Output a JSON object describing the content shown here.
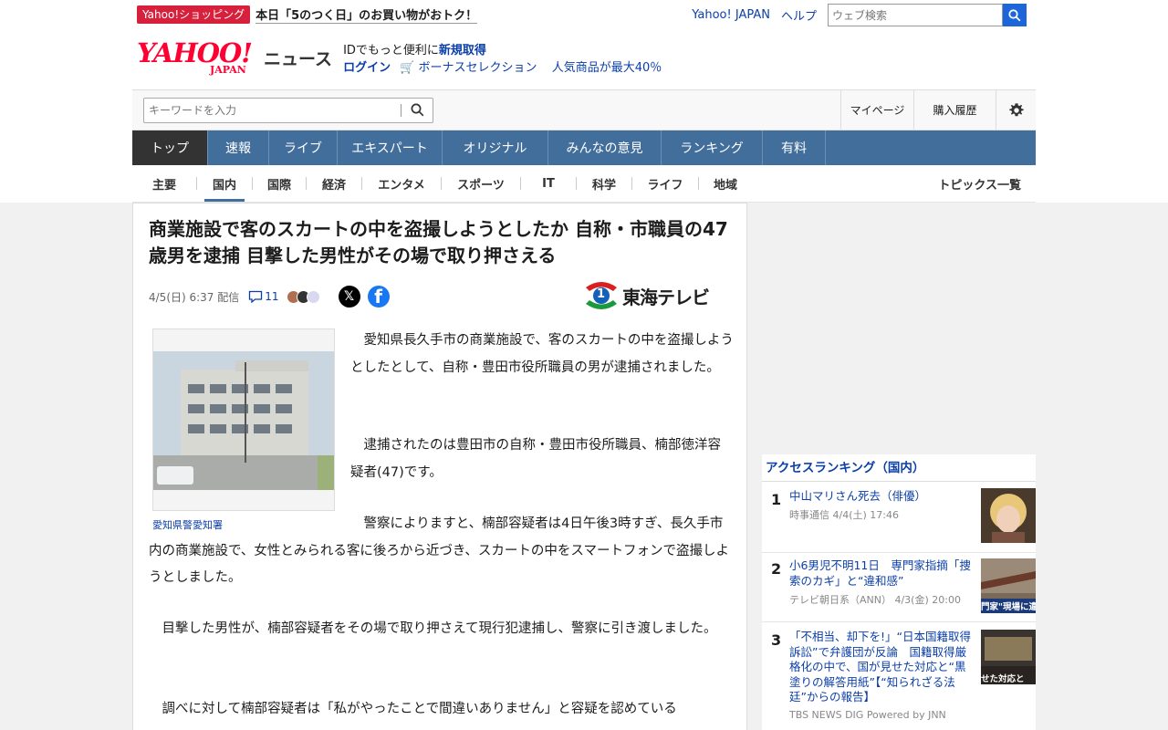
{
  "promo": {
    "badge": "Yahoo!ショッピング",
    "text": "本日「5のつく日」のお買い物がおトク！"
  },
  "header_links": {
    "yahoo_japan": "Yahoo! JAPAN",
    "help": "ヘルプ"
  },
  "web_search": {
    "placeholder": "ウェブ検索"
  },
  "logo": {
    "main": "YAHOO!",
    "sub": "JAPAN",
    "service": "ニュース"
  },
  "id_promo": {
    "line1_prefix": "IDでもっと便利に",
    "line1_link": "新規取得",
    "login": "ログイン",
    "bonus": "ボーナスセレクション",
    "popular": "人気商品が最大40％"
  },
  "keyword_search": {
    "placeholder": "キーワードを入力"
  },
  "util": {
    "mypage": "マイページ",
    "history": "購入履歴"
  },
  "main_nav": [
    "トップ",
    "速報",
    "ライブ",
    "エキスパート",
    "オリジナル",
    "みんなの意見",
    "ランキング",
    "有料"
  ],
  "sub_nav": [
    "主要",
    "国内",
    "国際",
    "経済",
    "エンタメ",
    "スポーツ",
    "IT",
    "科学",
    "ライフ",
    "地域"
  ],
  "topics_link": "トピックス一覧",
  "article": {
    "title": "商業施設で客のスカートの中を盗撮しようとしたか 自称・市職員の47歳男を逮捕 目撃した男性がその場で取り押さえる",
    "date": "4/5(日) 6:37 配信",
    "comment_count": "11",
    "source": "東海テレビ",
    "source_mark": "1",
    "photo_caption": "愛知県警愛知署",
    "paragraphs": [
      "　愛知県長久手市の商業施設で、客のスカートの中を盗撮しようとしたとして、自称・豊田市役所職員の男が逮捕されました。",
      "　逮捕されたのは豊田市の自称・豊田市役所職員、楠部徳洋容疑者(47)です。",
      "　警察によりますと、楠部容疑者は4日午後3時すぎ、長久手市内の商業施設で、女性とみられる客に後ろから近づき、スカートの中をスマートフォンで盗撮しようとしました。",
      "　目撃した男性が、楠部容疑者をその場で取り押さえて現行犯逮捕し、警察に引き渡しました。",
      "　調べに対して楠部容疑者は「私がやったことで間違いありません」と容疑を認めている"
    ]
  },
  "ranking": {
    "heading": "アクセスランキング（国内）",
    "items": [
      {
        "rank": "1",
        "title": "中山マリさん死去（俳優）",
        "source": "時事通信 4/4(土) 17:46"
      },
      {
        "rank": "2",
        "title": "小6男児不明11日　専門家指摘「捜索のカギ」と“違和感”",
        "source": "テレビ朝日系（ANN）  4/3(金) 20:00",
        "thumb_text": "門家\"現場に違"
      },
      {
        "rank": "3",
        "title": "「不相当、却下を!」“日本国籍取得訴訟”で弁護団が反論　国籍取得厳格化の中で、国が見せた対応と“黒塗りの解答用紙”【“知られざる法廷”からの報告】",
        "source": "TBS NEWS DIG Powered by JNN",
        "thumb_text": "せた対応と"
      }
    ]
  }
}
